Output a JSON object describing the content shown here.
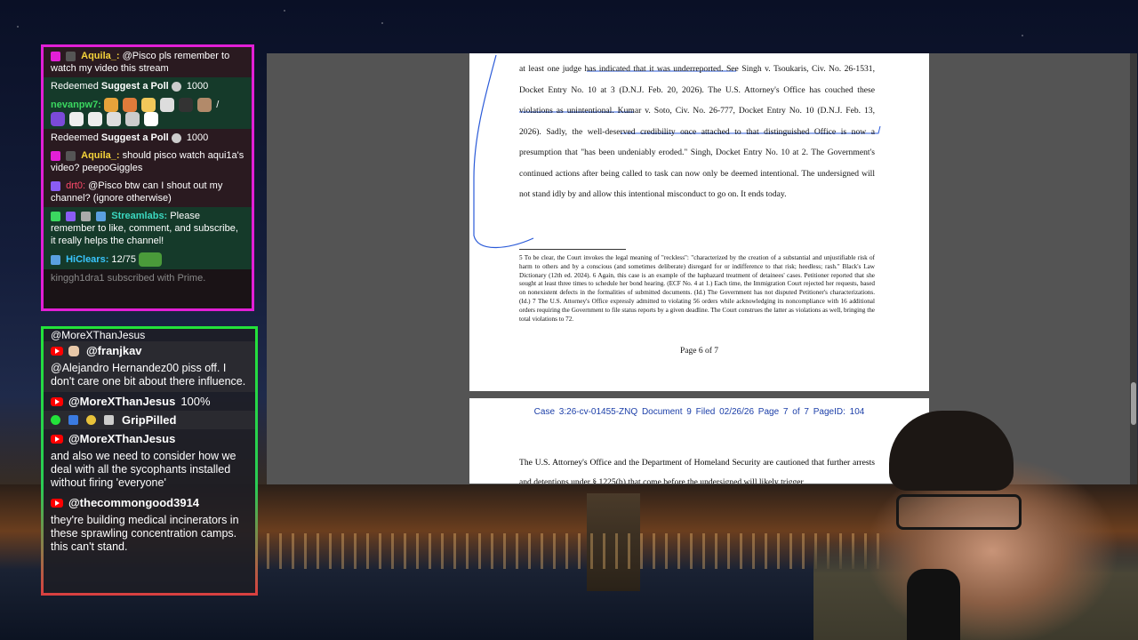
{
  "chat_twitch": {
    "messages": [
      {
        "user": "Aquila_:",
        "text": "@Pisco pls remember to watch my video this stream"
      },
      {
        "redeem": "Redeemed",
        "reward": "Suggest a Poll",
        "cost": "1000"
      },
      {
        "user": "nevanpw7:",
        "text": "/"
      },
      {
        "redeem": "Redeemed",
        "reward": "Suggest a Poll",
        "cost": "1000"
      },
      {
        "user": "Aquila_:",
        "text": "should pisco watch aqui1a's video? peepoGiggles"
      },
      {
        "user": "drt0:",
        "text": "@Pisco btw can I shout out my channel? (ignore otherwise)"
      },
      {
        "user": "Streamlabs:",
        "text": "Please remember to like, comment, and subscribe, it really helps the channel!"
      },
      {
        "user": "HiClears:",
        "text": "12/75"
      }
    ],
    "sub_notice": "kinggh1dra1 subscribed with Prime."
  },
  "chat_youtube": {
    "cut_top": "@MoreXThanJesus",
    "items": [
      {
        "name": "@franjkav",
        "text": "@Alejandro Hernandez00 piss off. I don't care one bit about there influence."
      },
      {
        "name": "@MoreXThanJesus",
        "suffix": "100%"
      },
      {
        "name": "GripPilled",
        "text": ""
      },
      {
        "name": "@MoreXThanJesus",
        "text": "and also we need to consider how we deal with all the sycophants installed without firing 'everyone'"
      },
      {
        "name": "@thecommongood3914",
        "text": "they're building medical incinerators in these sprawling concentration camps. this can't stand."
      }
    ]
  },
  "document": {
    "page6_body": "at least one judge has indicated that it was underreported. See Singh v. Tsoukaris, Civ. No. 26-1531, Docket Entry No. 10 at 3 (D.N.J. Feb. 20, 2026). The U.S. Attorney's Office has couched these violations as unintentional. Kumar v. Soto, Civ. No. 26-777, Docket Entry No. 10 (D.N.J. Feb. 13, 2026). Sadly, the well-deserved credibility once attached to that distinguished Office is now a presumption that \"has been undeniably eroded.\" Singh, Docket Entry No. 10 at 2. The Government's continued actions after being called to task can now only be deemed intentional. The undersigned will not stand idly by and allow this intentional misconduct to go on. It ends today.",
    "footnotes": "5 To be clear, the Court invokes the legal meaning of \"reckless\": \"characterized by the creation of a substantial and unjustifiable risk of harm to others and by a conscious (and sometimes deliberate) disregard for or indifference to that risk; heedless; rash.\" Black's Law Dictionary (12th ed. 2024). 6 Again, this case is an example of the haphazard treatment of detainees' cases. Petitioner reported that she sought at least three times to schedule her bond hearing. (ECF No. 4 at 1.) Each time, the Immigration Court rejected her requests, based on nonexistent defects in the formalities of submitted documents. (Id.) The Government has not disputed Petitioner's characterizations. (Id.) 7 The U.S. Attorney's Office expressly admitted to violating 56 orders while acknowledging its noncompliance with 16 additional orders requiring the Government to file status reports by a given deadline. The Court construes the latter as violations as well, bringing the total violations to 72.",
    "page_label": "Page 6 of 7",
    "page7_header": "Case 3:26-cv-01455-ZNQ   Document 9   Filed 02/26/26   Page 7 of 7 PageID: 104",
    "page7_body": "The U.S. Attorney's Office and the Department of Homeland Security are cautioned that further arrests and detentions under § 1225(b) that come before the undersigned will likely trigger"
  },
  "colors": {
    "twitch_border": "#e21fd6",
    "yt_border": "#23e23a",
    "doc_link": "#1b3ea8"
  }
}
